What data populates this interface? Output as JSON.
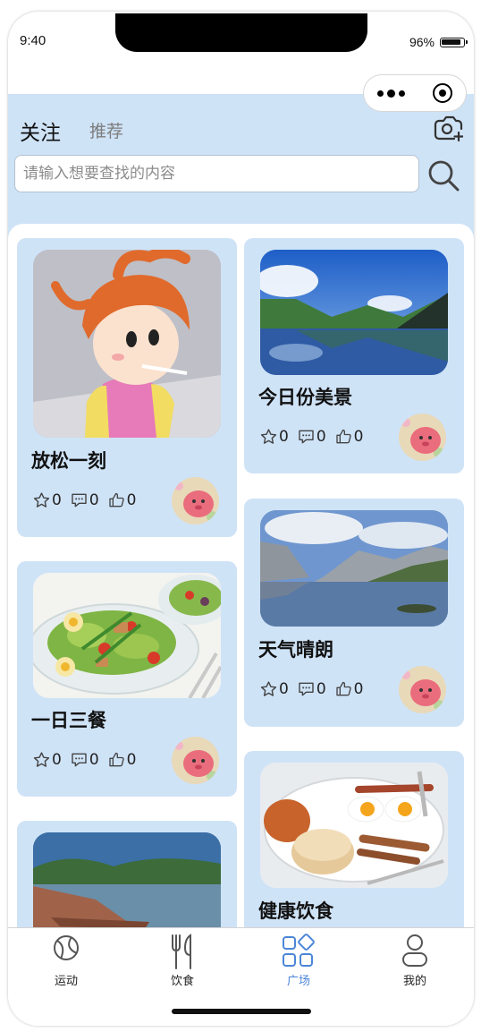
{
  "status": {
    "time": "9:40",
    "battery": "96%"
  },
  "header": {
    "tabs": [
      {
        "label": "关注",
        "active": true
      },
      {
        "label": "推荐",
        "active": false
      }
    ],
    "camera_icon": "camera-plus-icon",
    "search": {
      "placeholder": "请输入想要查找的内容",
      "value": ""
    },
    "search_icon": "search-icon"
  },
  "colors": {
    "header_bg": "#cfe3f7",
    "card_bg": "#cfe3f7",
    "active_tab": "#4b86d8"
  },
  "feed": {
    "left": [
      {
        "title": "放松一刻",
        "stars": "0",
        "comments": "0",
        "likes": "0",
        "image": "cartoon-girl-image"
      },
      {
        "title": "一日三餐",
        "stars": "0",
        "comments": "0",
        "likes": "0",
        "image": "salad-image"
      },
      {
        "title": "",
        "stars": "",
        "comments": "",
        "likes": "",
        "image": "lake-shore-image"
      }
    ],
    "right": [
      {
        "title": "今日份美景",
        "stars": "0",
        "comments": "0",
        "likes": "0",
        "image": "mountain-lake-image"
      },
      {
        "title": "天气晴朗",
        "stars": "0",
        "comments": "0",
        "likes": "0",
        "image": "valley-lake-image"
      },
      {
        "title": "健康饮食",
        "stars": "",
        "comments": "",
        "likes": "",
        "image": "breakfast-image"
      }
    ]
  },
  "tabbar": [
    {
      "label": "运动",
      "icon": "ball-icon",
      "active": false
    },
    {
      "label": "饮食",
      "icon": "utensils-icon",
      "active": false
    },
    {
      "label": "广场",
      "icon": "square-grid-icon",
      "active": true
    },
    {
      "label": "我的",
      "icon": "person-icon",
      "active": false
    }
  ]
}
